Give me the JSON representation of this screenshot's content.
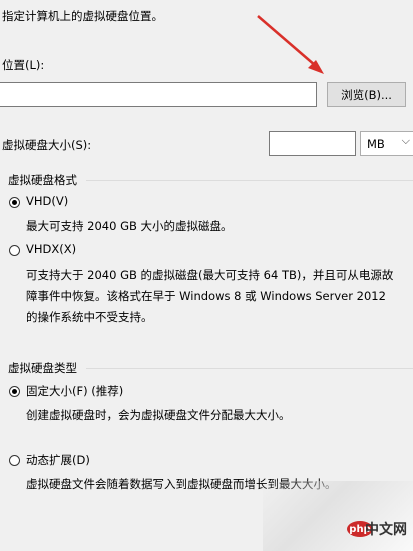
{
  "header": {
    "instruction": "指定计算机上的虚拟硬盘位置。"
  },
  "location": {
    "label": "位置(L):",
    "value": "",
    "browse_label": "浏览(B)..."
  },
  "size": {
    "label": "虚拟硬盘大小(S):",
    "value": "",
    "unit": "MB"
  },
  "format": {
    "title": "虚拟硬盘格式",
    "options": [
      {
        "label": "VHD(V)",
        "selected": true,
        "desc": "最大可支持 2040 GB 大小的虚拟磁盘。"
      },
      {
        "label": "VHDX(X)",
        "selected": false,
        "desc_lines": [
          "可支持大于 2040 GB 的虚拟磁盘(最大可支持 64 TB)，并且可从电源故",
          "障事件中恢复。该格式在早于 Windows 8 或 Windows Server 2012",
          "的操作系统中不受支持。"
        ]
      }
    ]
  },
  "type": {
    "title": "虚拟硬盘类型",
    "options": [
      {
        "label": "固定大小(F) (推荐)",
        "selected": true,
        "desc": "创建虚拟硬盘时，会为虚拟硬盘文件分配最大大小。"
      },
      {
        "label": "动态扩展(D)",
        "selected": false,
        "desc": "虚拟硬盘文件会随着数据写入到虚拟硬盘而增长到最大大小。"
      }
    ]
  },
  "watermark": {
    "logo_text": "php",
    "site_text": "中文网"
  },
  "colors": {
    "arrow": "#d9302a"
  }
}
